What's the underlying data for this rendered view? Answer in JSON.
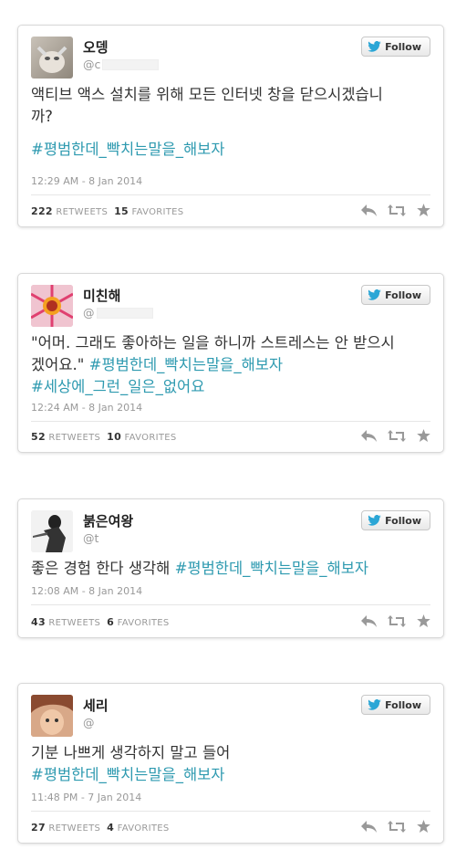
{
  "follow_label": "Follow",
  "retweets_label": "RETWEETS",
  "favorites_label": "FAVORITES",
  "tweets": [
    {
      "name": "오뎅",
      "handle": "@c",
      "text_line1": "액티브 액스 설치를 위해 모든 인터넷 창을 닫으시겠습니",
      "text_line2": "까?",
      "hashtag1": "#평범한데_빡치는말을_해보자",
      "timestamp": "12:29 AM - 8 Jan 2014",
      "retweets": "222",
      "favorites": "15"
    },
    {
      "name": "미친해",
      "handle": "@",
      "text_line1": "\"어머. 그래도 좋아하는 일을 하니까 스트레스는 안 받으시",
      "text_line2": "겠어요.\"",
      "hashtag1": "#평범한데_빡치는말을_해보자",
      "hashtag2": "#세상에_그런_일은_없어요",
      "timestamp": "12:24 AM - 8 Jan 2014",
      "retweets": "52",
      "favorites": "10"
    },
    {
      "name": "붉은여왕",
      "handle": "@t",
      "text_line1": "좋은 경험 한다 생각해",
      "hashtag1": "#평범한데_빡치는말을_해보자",
      "timestamp": "12:08 AM - 8 Jan 2014",
      "retweets": "43",
      "favorites": "6"
    },
    {
      "name": "세리",
      "handle": "@",
      "text_line1": "기분 나쁘게 생각하지 말고 들어",
      "hashtag1": "#평범한데_빡치는말을_해보자",
      "timestamp": "11:48 PM - 7 Jan 2014",
      "retweets": "27",
      "favorites": "4"
    }
  ]
}
